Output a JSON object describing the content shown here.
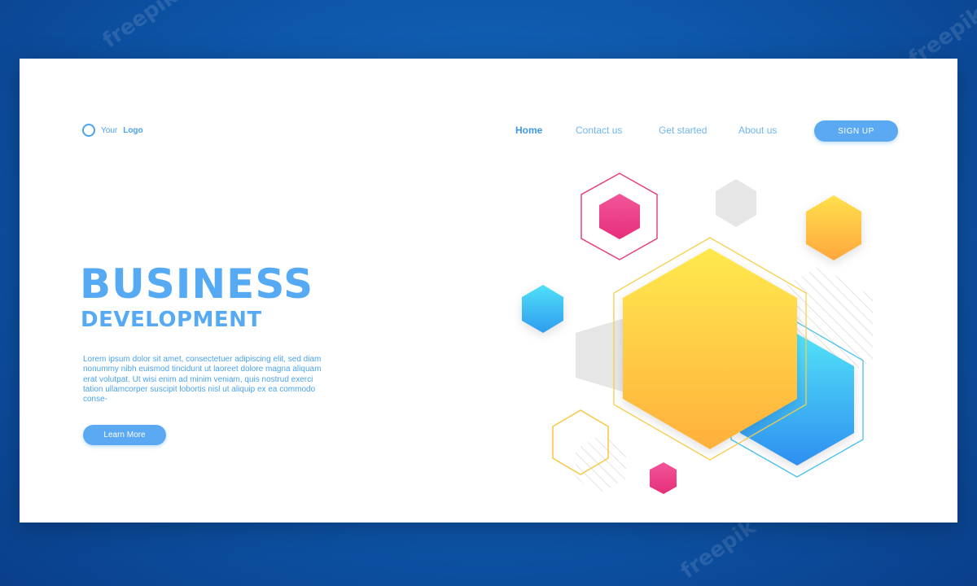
{
  "logo": {
    "prefix": "Your",
    "strong": "Logo"
  },
  "nav": {
    "home": "Home",
    "contact": "Contact us",
    "get_started": "Get started",
    "about": "About us"
  },
  "signup_label": "SIGN UP",
  "hero": {
    "title": "BUSINESS",
    "subtitle": "DEVELOPMENT",
    "body": "Lorem ipsum dolor sit amet, consectetuer adipiscing elit, sed diam nonummy nibh euismod tincidunt ut laoreet dolore magna aliquam erat volutpat. Ut wisi enim ad minim veniam, quis nostrud exerci tation ullamcorper suscipit lobortis nisl ut aliquip ex ea commodo conse-",
    "cta": "Learn More"
  },
  "watermark_text": "freepik",
  "colors": {
    "background": "#0d55a8",
    "accent_blue": "#56aaf4",
    "pink": "#ee3f8c",
    "yellow": "#ffd84a",
    "orange": "#ffb347",
    "cyan": "#42c3f7",
    "gray": "#e6e6e6"
  }
}
